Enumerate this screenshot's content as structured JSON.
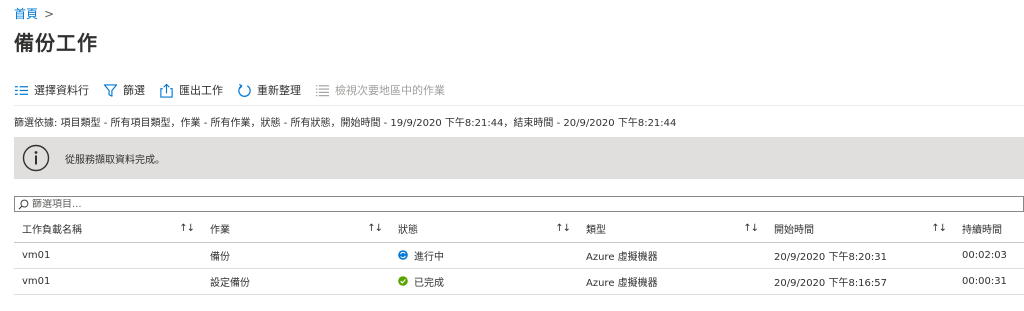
{
  "breadcrumb": {
    "home": "首頁",
    "separator": ">"
  },
  "page": {
    "title": "備份工作"
  },
  "toolbar": {
    "choose_columns": "選擇資料行",
    "filter": "篩選",
    "export": "匯出工作",
    "refresh": "重新整理",
    "secondary_region": "檢視次要地區中的作業"
  },
  "filter_summary": "篩選依據: 項目類型 - 所有項目類型，作業 - 所有作業，狀態 - 所有狀態，開始時間 - 19/9/2020 下午8:21:44，結束時間 - 20/9/2020 下午8:21:44",
  "info_bar": {
    "message": "從服務擷取資料完成。"
  },
  "search": {
    "placeholder": "篩選項目..."
  },
  "table": {
    "columns": [
      "工作負載名稱",
      "作業",
      "狀態",
      "類型",
      "開始時間",
      "持續時間"
    ],
    "sort_symbol": "↑↓",
    "rows": [
      {
        "workload": "vm01",
        "operation": "備份",
        "status": "進行中",
        "status_kind": "in-progress",
        "type": "Azure 虛擬機器",
        "start": "20/9/2020 下午8:20:31",
        "duration": "00:02:03"
      },
      {
        "workload": "vm01",
        "operation": "設定備份",
        "status": "已完成",
        "status_kind": "completed",
        "type": "Azure 虛擬機器",
        "start": "20/9/2020 下午8:16:57",
        "duration": "00:00:31"
      }
    ]
  },
  "colors": {
    "accent": "#0078d4",
    "success": "#57a300",
    "info_bg": "#e1dfdd"
  }
}
